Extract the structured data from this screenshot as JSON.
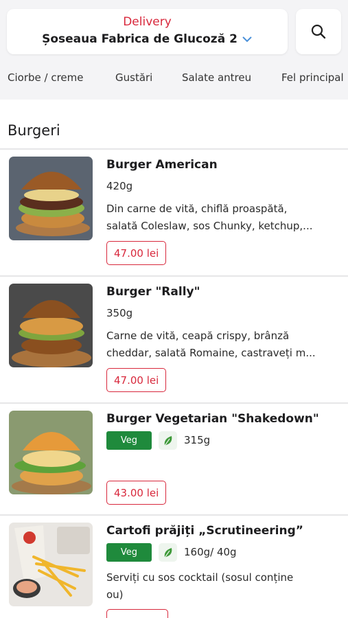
{
  "header": {
    "delivery_label": "Delivery",
    "address": "Șoseaua Fabrica de Glucoză 2"
  },
  "categories": [
    "Ciorbe / creme",
    "Gustări",
    "Salate antreu",
    "Fel principal"
  ],
  "section": {
    "title": "Burgeri"
  },
  "items": [
    {
      "name": "Burger American",
      "weight": "420g",
      "description_line1": "Din carne de vită, chiflă proaspătă,",
      "description_line2": "salată Coleslaw, sos Chunky, ketchup,...",
      "price": "47.00 lei"
    },
    {
      "name": "Burger \"Rally\"",
      "weight": "350g",
      "description_line1": "Carne de vită, ceapă crispy, brânză",
      "description_line2": "cheddar, salată Romaine, castraveți m...",
      "price": "47.00 lei"
    },
    {
      "name": "Burger Vegetarian \"Shakedown\"",
      "badge": "Veg",
      "weight": "315g",
      "price": "43.00 lei"
    },
    {
      "name": "Cartofi prăjiți „Scrutineering”",
      "badge": "Veg",
      "weight": "160g/ 40g",
      "description_line1": "Serviți cu sos cocktail (sosul conține",
      "description_line2": "ou)"
    }
  ],
  "colors": {
    "accent": "#d8283c",
    "veg": "#1f8a3c"
  }
}
